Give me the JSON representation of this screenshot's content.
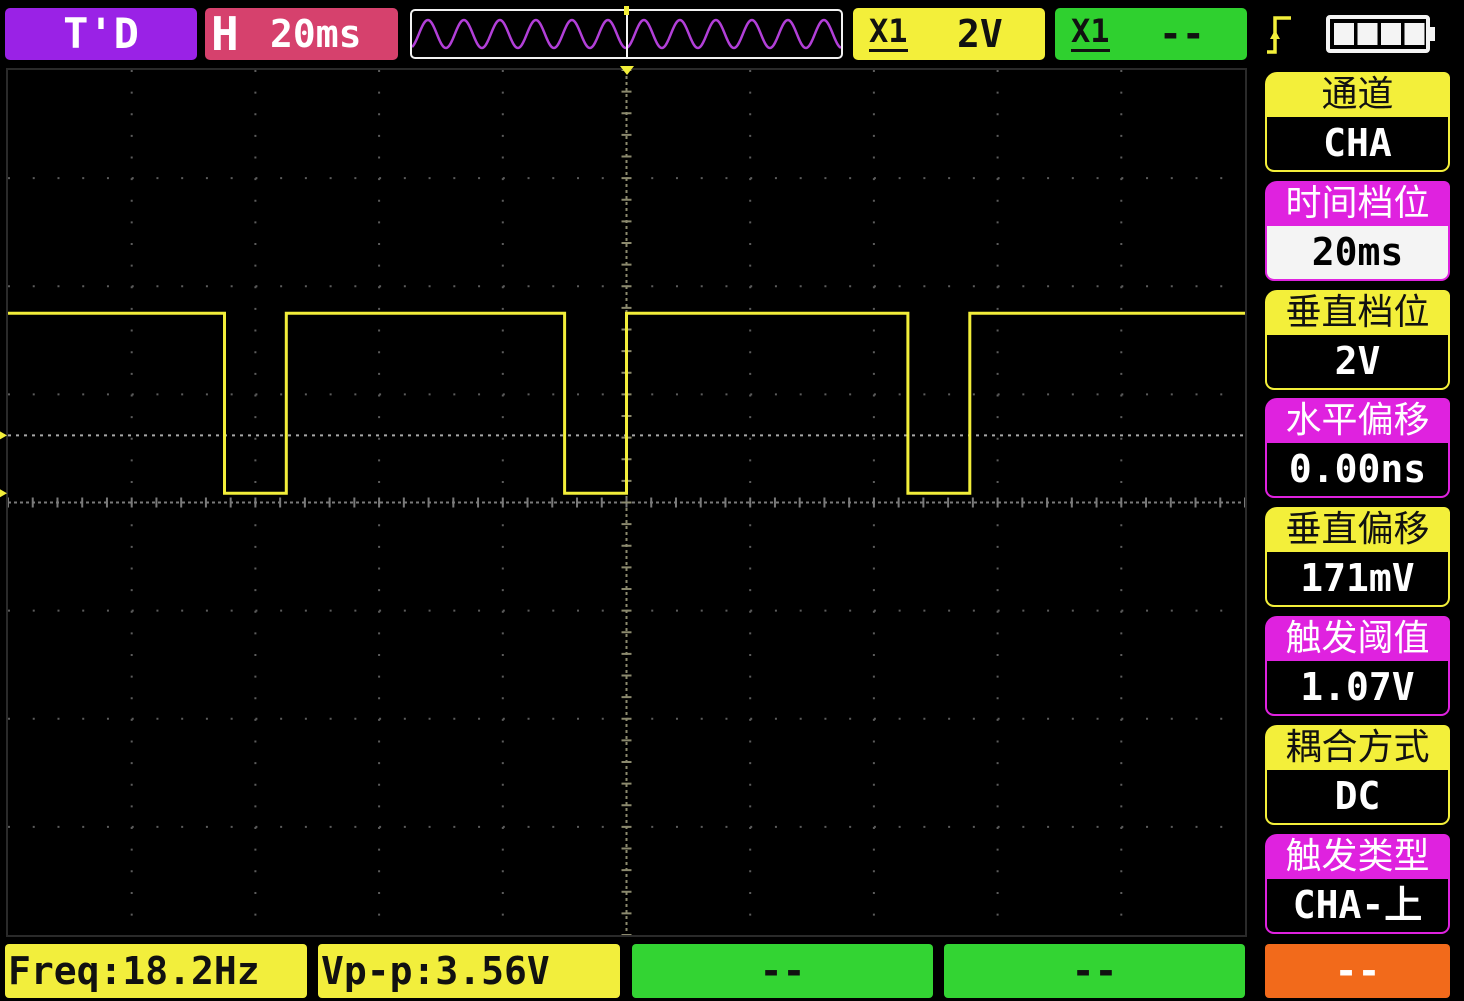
{
  "top_bar": {
    "trigger_status": "T'D",
    "timebase_prefix": "H",
    "timebase": "20ms",
    "channel_a": {
      "probe": "X1",
      "scale": "2V"
    },
    "channel_b": {
      "probe": "X1",
      "scale": "--"
    },
    "trigger_edge_icon": "rising-edge-icon",
    "battery_icon": "battery-icon",
    "battery_level": 1.0
  },
  "menu": [
    {
      "label": "通道",
      "value": "CHA",
      "header_color": "#f3ef3a",
      "header_text_color": "#111111"
    },
    {
      "label": "时间档位",
      "value": "20ms",
      "header_color": "#df22df",
      "header_text_color": "#ffffff",
      "selected": true
    },
    {
      "label": "垂直档位",
      "value": "2V",
      "header_color": "#f3ef3a",
      "header_text_color": "#111111"
    },
    {
      "label": "水平偏移",
      "value": "0.00ns",
      "header_color": "#df22df",
      "header_text_color": "#ffffff"
    },
    {
      "label": "垂直偏移",
      "value": "171mV",
      "header_color": "#f3ef3a",
      "header_text_color": "#111111"
    },
    {
      "label": "触发阈值",
      "value": "1.07V",
      "header_color": "#df22df",
      "header_text_color": "#ffffff"
    },
    {
      "label": "耦合方式",
      "value": "DC",
      "header_color": "#f3ef3a",
      "header_text_color": "#111111"
    },
    {
      "label": "触发类型",
      "value": "CHA-上",
      "header_color": "#df22df",
      "header_text_color": "#ffffff"
    }
  ],
  "measurements": [
    {
      "text": "Freq:18.2Hz",
      "color": "#f2ee3c"
    },
    {
      "text": "Vp-p:3.56V",
      "color": "#f2ee3c"
    },
    {
      "text": "--",
      "color": "#33d433"
    },
    {
      "text": "--",
      "color": "#33d433"
    },
    {
      "text": "--",
      "color": "#f26a1b"
    }
  ],
  "display": {
    "trace_points_ms_v": [
      [
        -100,
        3.33
      ],
      [
        -65,
        3.33
      ],
      [
        -65,
        0
      ],
      [
        -55,
        0
      ],
      [
        -55,
        3.33
      ],
      [
        -10,
        3.33
      ],
      [
        -10,
        0
      ],
      [
        0,
        0
      ],
      [
        0,
        3.33
      ],
      [
        45.5,
        3.33
      ],
      [
        45.5,
        0
      ],
      [
        55.5,
        0
      ],
      [
        55.5,
        3.33
      ],
      [
        100,
        3.33
      ]
    ]
  },
  "colors": {
    "trigger_status_bg": "#9a22e6",
    "timebase_bg": "#d6416d",
    "channel_a": "#f3ef3a",
    "channel_b": "#2fd02f",
    "trace": "#f2ee3a",
    "preview_wave": "#b23fd8",
    "grid": "#5c5c5c",
    "selected_value_bg": "#f4f4f4",
    "selected_value_text": "#000000"
  }
}
